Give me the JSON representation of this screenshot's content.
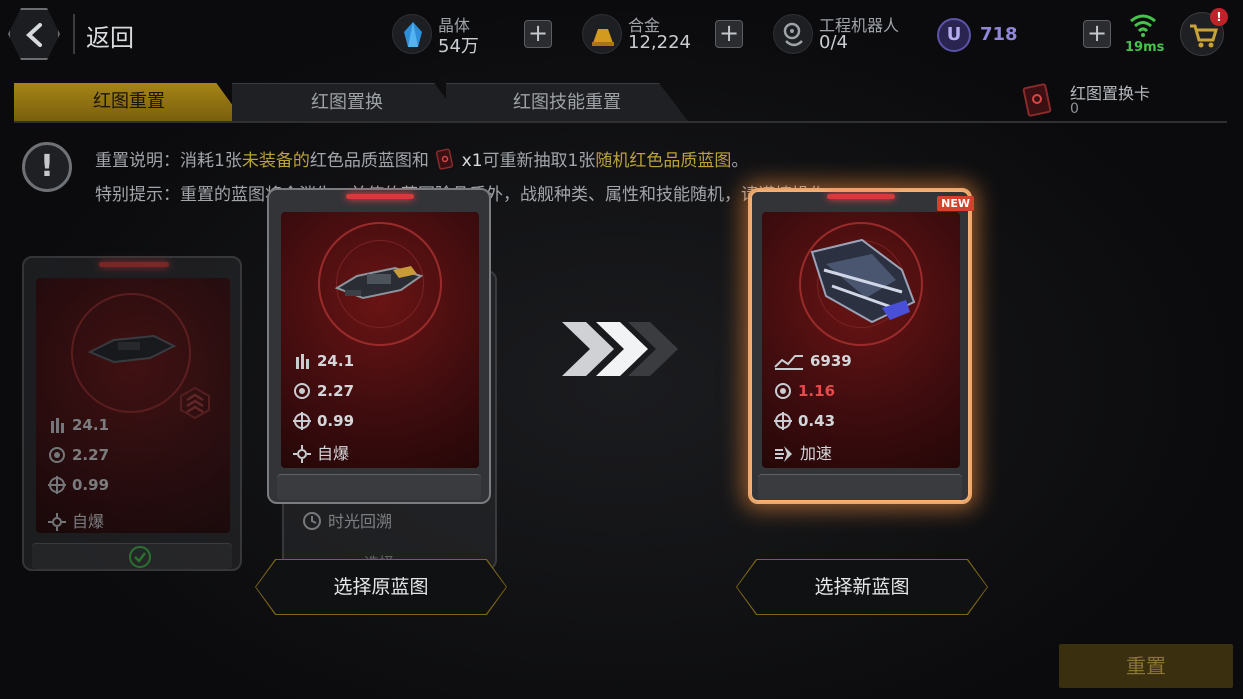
{
  "topbar": {
    "back_label": "返回",
    "resources": [
      {
        "name": "晶体",
        "value": "54万",
        "icon": "crystal-icon"
      },
      {
        "name": "合金",
        "value": "12,224",
        "icon": "alloy-icon"
      },
      {
        "name": "工程机器人",
        "value": "0/4",
        "icon": "robot-icon"
      }
    ],
    "u_badge": "U",
    "u_value": "718",
    "ping": "19ms",
    "cart_badge": "!"
  },
  "tabs": [
    {
      "label": "红图重置",
      "active": true
    },
    {
      "label": "红图置换",
      "active": false
    },
    {
      "label": "红图技能重置",
      "active": false
    }
  ],
  "swap_card": {
    "label": "红图置换卡",
    "count": "0"
  },
  "info": {
    "icon_text": "!",
    "line1": {
      "a": "重置说明：消耗1张",
      "b": "未装备的",
      "c": "红色品质蓝图和",
      "d": "x1",
      "e": "可重新抽取1张",
      "f": "随机红色品质蓝图",
      "g": "。"
    },
    "line2": "特别提示：重置的蓝图将会消失，并使的蓝图除品质外，战舰种类、属性和技能随机，请谨慎操作"
  },
  "cards": {
    "left_faded": {
      "stats": [
        "24.1",
        "2.27",
        "0.99"
      ],
      "skill": "自爆"
    },
    "back_card": {
      "skill": "时光回溯",
      "button": "选择"
    },
    "original": {
      "stats": [
        "24.1",
        "2.27",
        "0.99"
      ],
      "skill": "自爆"
    },
    "new": {
      "badge": "NEW",
      "stats": [
        "6939",
        "1.16",
        "0.43"
      ],
      "skill": "加速"
    }
  },
  "buttons": {
    "select_original": "选择原蓝图",
    "select_new": "选择新蓝图",
    "reset": "重置"
  },
  "colors": {
    "accent_gold": "#a68417",
    "card_red": "#6a1414",
    "glow_orange": "#f0a86a",
    "ping_green": "#45c34a",
    "stat_red": "#e44c4c"
  }
}
